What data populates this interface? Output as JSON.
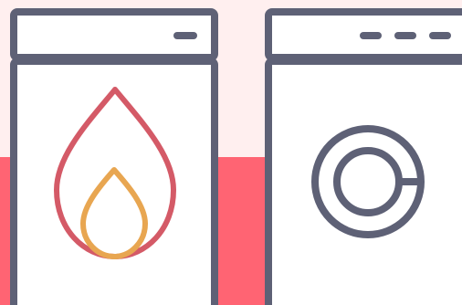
{
  "colors": {
    "background_top": "#FFEFEF",
    "background_bottom": "#FF6473",
    "appliance_outline": "#5E6176",
    "appliance_fill": "#FFFFFF",
    "flame_outer": "#D45A67",
    "flame_inner": "#E8A651",
    "washer_ring": "#5E6176"
  },
  "icons": {
    "left_appliance": "water-heater-icon",
    "flame": "flame-icon",
    "right_appliance": "washing-machine-icon",
    "drum": "washer-drum-icon"
  }
}
